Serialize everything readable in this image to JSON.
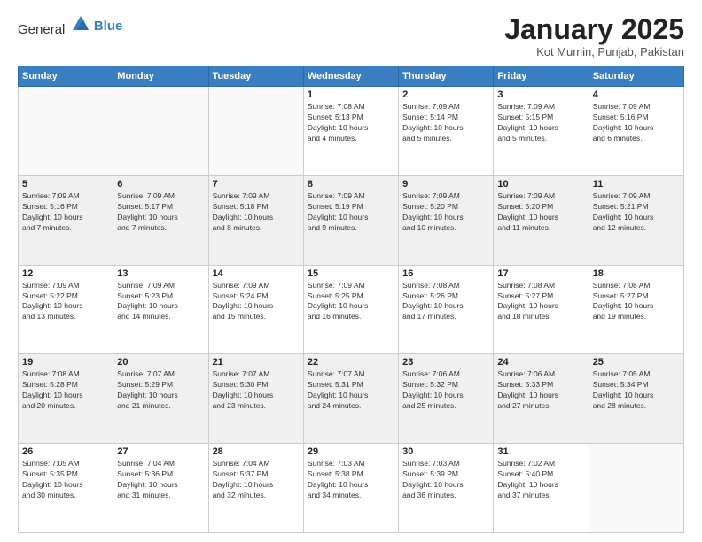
{
  "header": {
    "logo_general": "General",
    "logo_blue": "Blue",
    "title": "January 2025",
    "subtitle": "Kot Mumin, Punjab, Pakistan"
  },
  "weekdays": [
    "Sunday",
    "Monday",
    "Tuesday",
    "Wednesday",
    "Thursday",
    "Friday",
    "Saturday"
  ],
  "weeks": [
    {
      "shade": "white",
      "days": [
        {
          "date": "",
          "info": ""
        },
        {
          "date": "",
          "info": ""
        },
        {
          "date": "",
          "info": ""
        },
        {
          "date": "1",
          "info": "Sunrise: 7:08 AM\nSunset: 5:13 PM\nDaylight: 10 hours\nand 4 minutes."
        },
        {
          "date": "2",
          "info": "Sunrise: 7:09 AM\nSunset: 5:14 PM\nDaylight: 10 hours\nand 5 minutes."
        },
        {
          "date": "3",
          "info": "Sunrise: 7:09 AM\nSunset: 5:15 PM\nDaylight: 10 hours\nand 5 minutes."
        },
        {
          "date": "4",
          "info": "Sunrise: 7:09 AM\nSunset: 5:16 PM\nDaylight: 10 hours\nand 6 minutes."
        }
      ]
    },
    {
      "shade": "shade",
      "days": [
        {
          "date": "5",
          "info": "Sunrise: 7:09 AM\nSunset: 5:16 PM\nDaylight: 10 hours\nand 7 minutes."
        },
        {
          "date": "6",
          "info": "Sunrise: 7:09 AM\nSunset: 5:17 PM\nDaylight: 10 hours\nand 7 minutes."
        },
        {
          "date": "7",
          "info": "Sunrise: 7:09 AM\nSunset: 5:18 PM\nDaylight: 10 hours\nand 8 minutes."
        },
        {
          "date": "8",
          "info": "Sunrise: 7:09 AM\nSunset: 5:19 PM\nDaylight: 10 hours\nand 9 minutes."
        },
        {
          "date": "9",
          "info": "Sunrise: 7:09 AM\nSunset: 5:20 PM\nDaylight: 10 hours\nand 10 minutes."
        },
        {
          "date": "10",
          "info": "Sunrise: 7:09 AM\nSunset: 5:20 PM\nDaylight: 10 hours\nand 11 minutes."
        },
        {
          "date": "11",
          "info": "Sunrise: 7:09 AM\nSunset: 5:21 PM\nDaylight: 10 hours\nand 12 minutes."
        }
      ]
    },
    {
      "shade": "white",
      "days": [
        {
          "date": "12",
          "info": "Sunrise: 7:09 AM\nSunset: 5:22 PM\nDaylight: 10 hours\nand 13 minutes."
        },
        {
          "date": "13",
          "info": "Sunrise: 7:09 AM\nSunset: 5:23 PM\nDaylight: 10 hours\nand 14 minutes."
        },
        {
          "date": "14",
          "info": "Sunrise: 7:09 AM\nSunset: 5:24 PM\nDaylight: 10 hours\nand 15 minutes."
        },
        {
          "date": "15",
          "info": "Sunrise: 7:09 AM\nSunset: 5:25 PM\nDaylight: 10 hours\nand 16 minutes."
        },
        {
          "date": "16",
          "info": "Sunrise: 7:08 AM\nSunset: 5:26 PM\nDaylight: 10 hours\nand 17 minutes."
        },
        {
          "date": "17",
          "info": "Sunrise: 7:08 AM\nSunset: 5:27 PM\nDaylight: 10 hours\nand 18 minutes."
        },
        {
          "date": "18",
          "info": "Sunrise: 7:08 AM\nSunset: 5:27 PM\nDaylight: 10 hours\nand 19 minutes."
        }
      ]
    },
    {
      "shade": "shade",
      "days": [
        {
          "date": "19",
          "info": "Sunrise: 7:08 AM\nSunset: 5:28 PM\nDaylight: 10 hours\nand 20 minutes."
        },
        {
          "date": "20",
          "info": "Sunrise: 7:07 AM\nSunset: 5:29 PM\nDaylight: 10 hours\nand 21 minutes."
        },
        {
          "date": "21",
          "info": "Sunrise: 7:07 AM\nSunset: 5:30 PM\nDaylight: 10 hours\nand 23 minutes."
        },
        {
          "date": "22",
          "info": "Sunrise: 7:07 AM\nSunset: 5:31 PM\nDaylight: 10 hours\nand 24 minutes."
        },
        {
          "date": "23",
          "info": "Sunrise: 7:06 AM\nSunset: 5:32 PM\nDaylight: 10 hours\nand 25 minutes."
        },
        {
          "date": "24",
          "info": "Sunrise: 7:06 AM\nSunset: 5:33 PM\nDaylight: 10 hours\nand 27 minutes."
        },
        {
          "date": "25",
          "info": "Sunrise: 7:05 AM\nSunset: 5:34 PM\nDaylight: 10 hours\nand 28 minutes."
        }
      ]
    },
    {
      "shade": "white",
      "days": [
        {
          "date": "26",
          "info": "Sunrise: 7:05 AM\nSunset: 5:35 PM\nDaylight: 10 hours\nand 30 minutes."
        },
        {
          "date": "27",
          "info": "Sunrise: 7:04 AM\nSunset: 5:36 PM\nDaylight: 10 hours\nand 31 minutes."
        },
        {
          "date": "28",
          "info": "Sunrise: 7:04 AM\nSunset: 5:37 PM\nDaylight: 10 hours\nand 32 minutes."
        },
        {
          "date": "29",
          "info": "Sunrise: 7:03 AM\nSunset: 5:38 PM\nDaylight: 10 hours\nand 34 minutes."
        },
        {
          "date": "30",
          "info": "Sunrise: 7:03 AM\nSunset: 5:39 PM\nDaylight: 10 hours\nand 36 minutes."
        },
        {
          "date": "31",
          "info": "Sunrise: 7:02 AM\nSunset: 5:40 PM\nDaylight: 10 hours\nand 37 minutes."
        },
        {
          "date": "",
          "info": ""
        }
      ]
    }
  ]
}
